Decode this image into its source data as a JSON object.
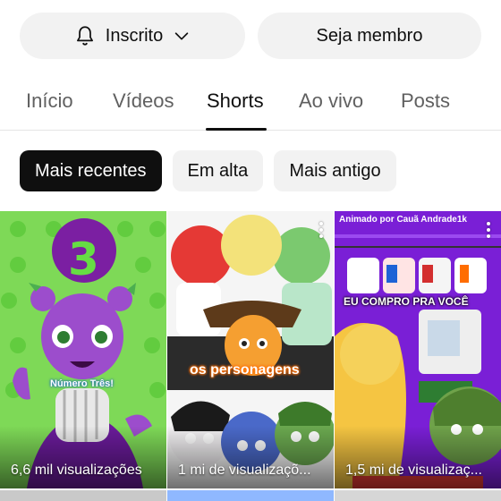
{
  "actions": {
    "subscribed_label": "Inscrito",
    "member_label": "Seja membro"
  },
  "tabs": [
    {
      "label": "Início"
    },
    {
      "label": "Vídeos"
    },
    {
      "label": "Shorts"
    },
    {
      "label": "Ao vivo"
    },
    {
      "label": "Posts"
    }
  ],
  "active_tab": "Shorts",
  "chips": [
    {
      "label": "Mais recentes"
    },
    {
      "label": "Em alta"
    },
    {
      "label": "Mais antigo"
    }
  ],
  "shorts": [
    {
      "views": "6,6 mil visualizações",
      "overlay": "Número Três!",
      "badge": "3"
    },
    {
      "views": "1 mi de visualizaçõ...",
      "overlay": "os personagens"
    },
    {
      "views": "1,5 mi de visualizaç...",
      "overlay": "EU COMPRO PRA VOCÊ",
      "credit": "Animado por Cauã Andrade1k"
    }
  ],
  "icons": {
    "bell": "bell-icon",
    "chevron": "chevron-down-icon",
    "more": "more-vert-icon"
  }
}
